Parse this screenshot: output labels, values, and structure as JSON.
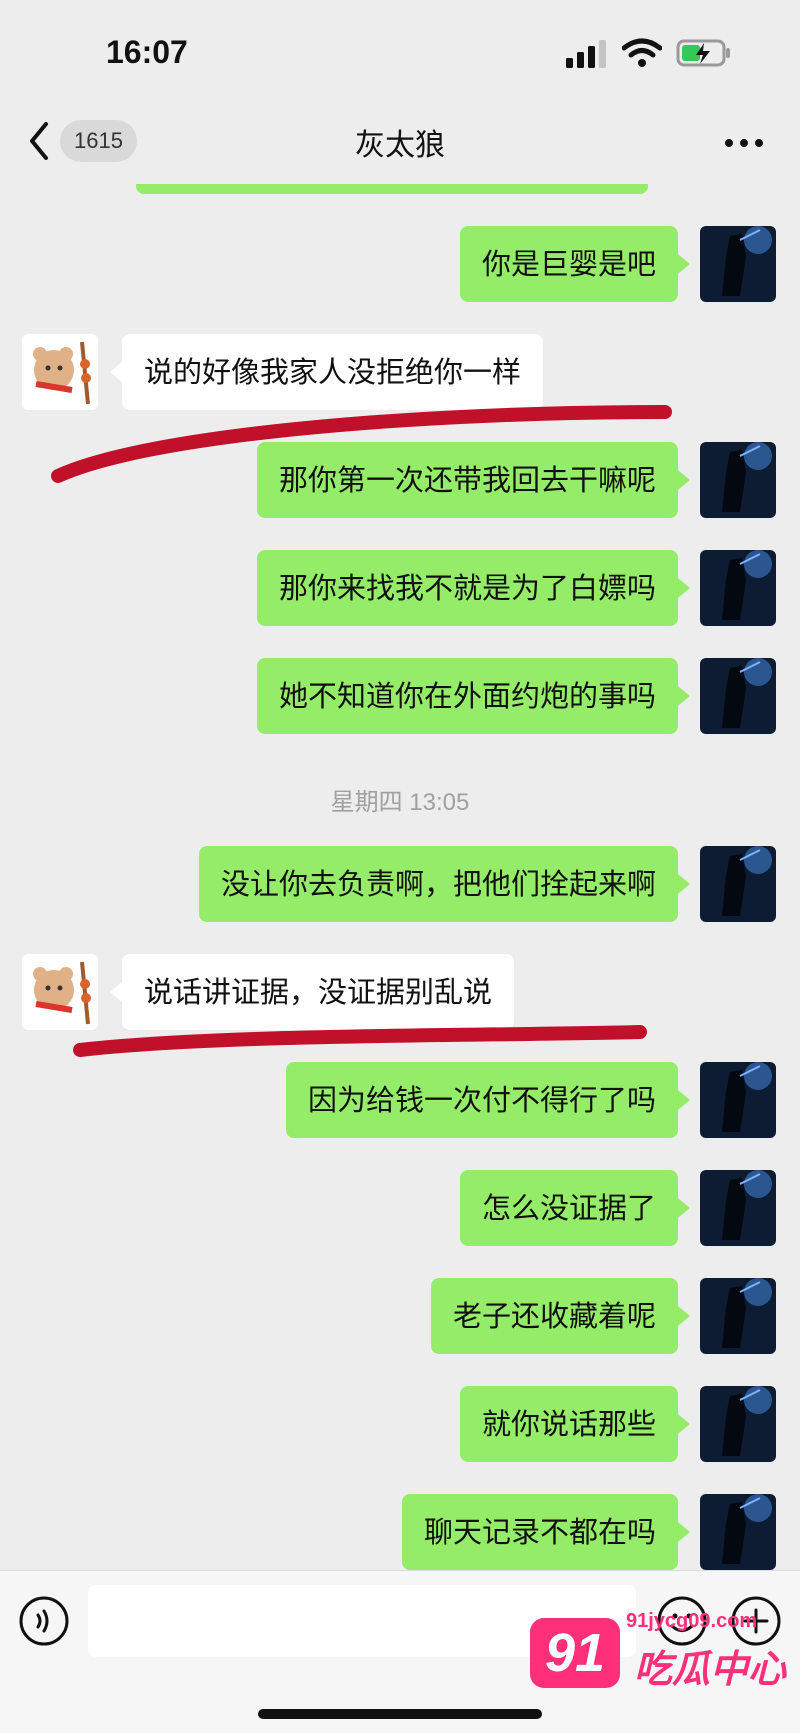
{
  "status_bar": {
    "time": "16:07"
  },
  "nav": {
    "unread_count": "1615",
    "title": "灰太狼"
  },
  "messages": [
    {
      "dir": "out",
      "text": "你是巨婴是吧"
    },
    {
      "dir": "in",
      "text": "说的好像我家人没拒绝你一样"
    },
    {
      "dir": "out",
      "text": "那你第一次还带我回去干嘛呢"
    },
    {
      "dir": "out",
      "text": "那你来找我不就是为了白嫖吗"
    },
    {
      "dir": "out",
      "text": "她不知道你在外面约炮的事吗"
    },
    {
      "dir": "out",
      "text": "没让你去负责啊，把他们拴起来啊"
    },
    {
      "dir": "in",
      "text": "说话讲证据，没证据别乱说"
    },
    {
      "dir": "out",
      "text": "因为给钱一次付不得行了吗"
    },
    {
      "dir": "out",
      "text": "怎么没证据了"
    },
    {
      "dir": "out",
      "text": "老子还收藏着呢"
    },
    {
      "dir": "out",
      "text": "就你说话那些"
    },
    {
      "dir": "out",
      "text": "聊天记录不都在吗"
    }
  ],
  "timestamp": "星期四 13:05",
  "watermark": {
    "logo": "91",
    "url": "91jycg09.com",
    "name": "吃瓜中心"
  },
  "colors": {
    "outgoing_bubble": "#95ec69",
    "incoming_bubble": "#ffffff",
    "background": "#ededed",
    "highlight": "#c0102a"
  }
}
